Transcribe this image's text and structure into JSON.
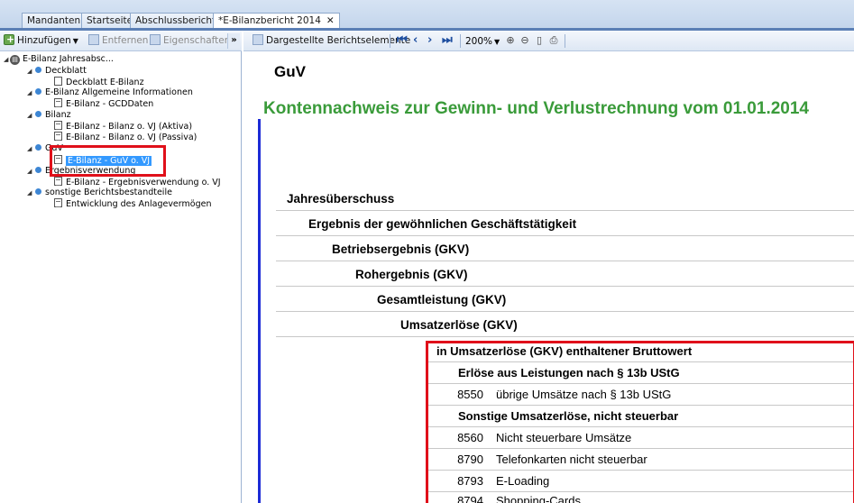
{
  "tabs": [
    {
      "label": "Mandanten",
      "active": false
    },
    {
      "label": "Startseite",
      "active": false
    },
    {
      "label": "Abschlussberichte",
      "active": false
    },
    {
      "label": "*E-Bilanzbericht 2014",
      "active": true,
      "close": "✕"
    }
  ],
  "left_toolbar": {
    "add_label": "Hinzufügen",
    "remove_label": "Entfernen",
    "properties_label": "Eigenschaften",
    "overflow": "»"
  },
  "tree": {
    "root": "E-Bilanz Jahresabsc...",
    "items": [
      {
        "label": "Deckblatt",
        "type": "group"
      },
      {
        "label": "Deckblatt E-Bilanz",
        "type": "page"
      },
      {
        "label": "E-Bilanz Allgemeine Informationen",
        "type": "group"
      },
      {
        "label": "E-Bilanz - GCDDaten",
        "type": "page"
      },
      {
        "label": "Bilanz",
        "type": "group"
      },
      {
        "label": "E-Bilanz - Bilanz o. VJ (Aktiva)",
        "type": "page"
      },
      {
        "label": "E-Bilanz - Bilanz o. VJ (Passiva)",
        "type": "page"
      },
      {
        "label": "GuV",
        "type": "group"
      },
      {
        "label": "E-Bilanz - GuV o. VJ",
        "type": "page",
        "selected": true
      },
      {
        "label": "Ergebnisverwendung",
        "type": "group"
      },
      {
        "label": "E-Bilanz - Ergebnisverwendung o. VJ",
        "type": "page"
      },
      {
        "label": "sonstige Berichtsbestandteile",
        "type": "group"
      },
      {
        "label": "Entwicklung des Anlagevermögen",
        "type": "page"
      }
    ]
  },
  "right_toolbar": {
    "elements_label": "Dargestellte Berichtselemente",
    "zoom": "200%"
  },
  "report": {
    "title": "GuV",
    "subtitle": "Kontennachweis zur Gewinn- und Verlustrechnung vom 01.01.2014",
    "rows": [
      "Jahresüberschuss",
      "Ergebnis der gewöhnlichen Geschäftstätigkeit",
      "Betriebsergebnis (GKV)",
      "Rohergebnis (GKV)",
      "Gesamtleistung (GKV)",
      "Umsatzerlöse (GKV)"
    ],
    "subrows": [
      {
        "code": "",
        "text": "in Umsatzerlöse (GKV) enthaltener Bruttowert",
        "bold": true
      },
      {
        "code": "",
        "text": "Erlöse aus Leistungen nach § 13b UStG",
        "bold": true
      },
      {
        "code": "8550",
        "text": "übrige Umsätze nach § 13b UStG",
        "bold": false
      },
      {
        "code": "",
        "text": "Sonstige Umsatzerlöse, nicht steuerbar",
        "bold": true
      },
      {
        "code": "8560",
        "text": "Nicht steuerbare Umsätze",
        "bold": false
      },
      {
        "code": "8790",
        "text": "Telefonkarten nicht steuerbar",
        "bold": false
      },
      {
        "code": "8793",
        "text": "E-Loading",
        "bold": false
      },
      {
        "code": "8794",
        "text": "Shopping-Cards",
        "bold": false
      }
    ]
  },
  "colors": {
    "subtitle_green": "#3a9b3a",
    "highlight_red": "#e0101a",
    "margin_bar_blue": "#1d2bd6",
    "selection_blue": "#3399ff"
  }
}
